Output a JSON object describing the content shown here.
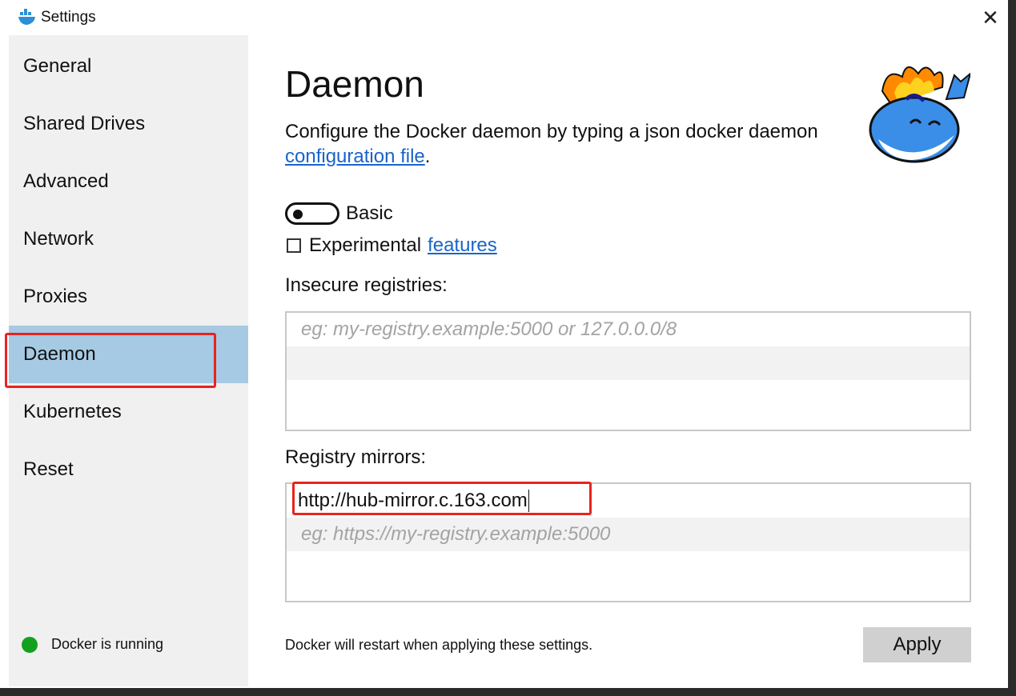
{
  "window": {
    "title": "Settings",
    "close_glyph": "✕"
  },
  "sidebar": {
    "items": [
      {
        "label": "General"
      },
      {
        "label": "Shared Drives"
      },
      {
        "label": "Advanced"
      },
      {
        "label": "Network"
      },
      {
        "label": "Proxies"
      },
      {
        "label": "Daemon",
        "active": true
      },
      {
        "label": "Kubernetes"
      },
      {
        "label": "Reset"
      }
    ],
    "status": {
      "text": "Docker is running",
      "color": "#14a01f"
    }
  },
  "main": {
    "title": "Daemon",
    "description": "Configure the Docker daemon by typing a json docker daemon",
    "description_link": "configuration file",
    "description_end": ".",
    "mode_toggle": {
      "label": "Basic",
      "on": false
    },
    "experimental": {
      "label": "Experimental",
      "link": "features",
      "checked": false
    },
    "insecure_registries": {
      "label": "Insecure registries:",
      "entries": [],
      "placeholder": "eg: my-registry.example:5000 or 127.0.0.0/8"
    },
    "registry_mirrors": {
      "label": "Registry mirrors:",
      "entries": [
        "http://hub-mirror.c.163.com"
      ],
      "placeholder": "eg: https://my-registry.example:5000"
    },
    "footer_note": "Docker will restart when applying these settings.",
    "apply_label": "Apply"
  },
  "colors": {
    "active_nav": "#a6cae3",
    "link": "#1a64c8",
    "highlight": "#e8231f"
  }
}
